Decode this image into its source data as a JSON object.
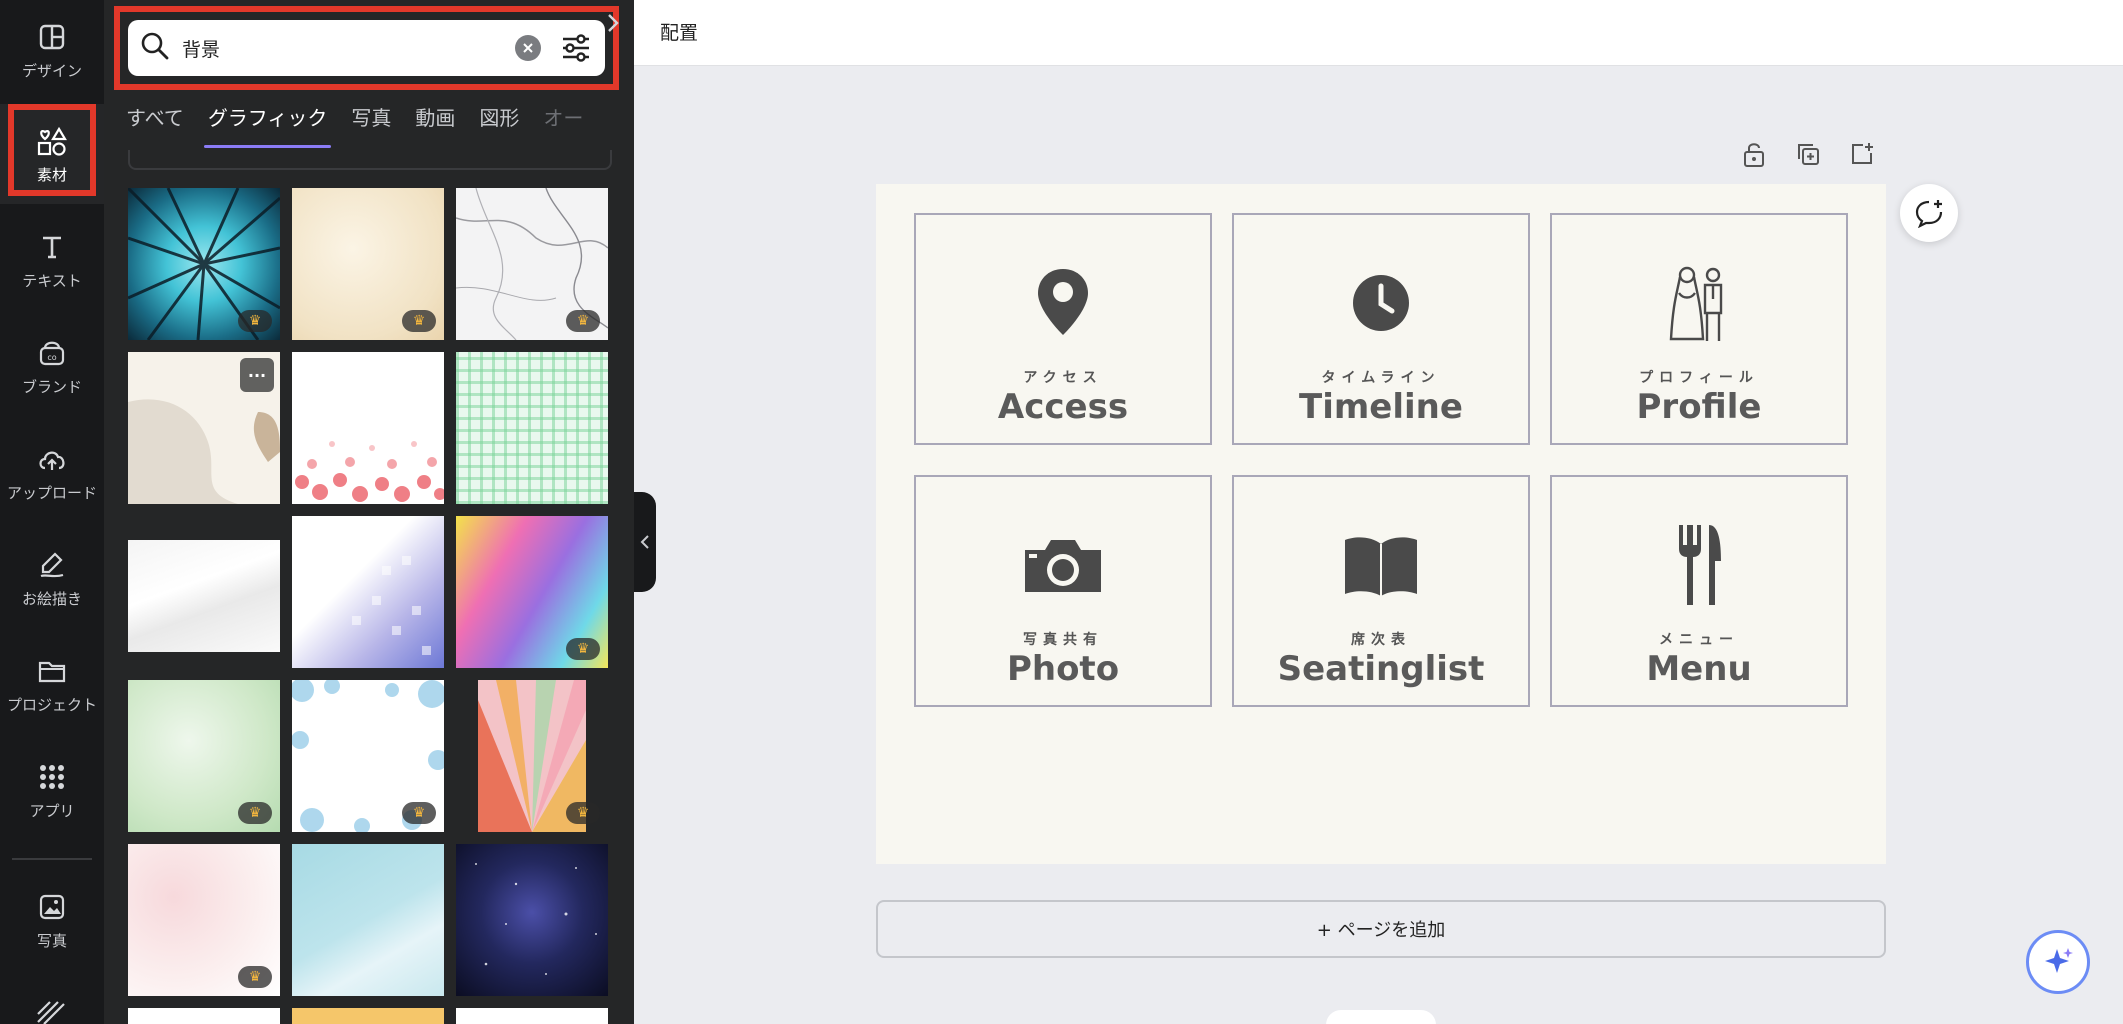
{
  "rail": {
    "items": [
      {
        "label": "デザイン",
        "icon": "layout-icon"
      },
      {
        "label": "素材",
        "icon": "elements-icon"
      },
      {
        "label": "テキスト",
        "icon": "text-icon"
      },
      {
        "label": "ブランド",
        "icon": "brand-icon"
      },
      {
        "label": "アップロード",
        "icon": "upload-cloud-icon"
      },
      {
        "label": "お絵描き",
        "icon": "draw-icon"
      },
      {
        "label": "プロジェクト",
        "icon": "folder-icon"
      },
      {
        "label": "アプリ",
        "icon": "apps-grid-icon"
      },
      {
        "label": "写真",
        "icon": "photo-icon"
      }
    ]
  },
  "search": {
    "value": "背景",
    "placeholder": ""
  },
  "tabs": [
    "すべて",
    "グラフィック",
    "写真",
    "動画",
    "図形",
    "オー"
  ],
  "topbar": {
    "title": "配置"
  },
  "cards": [
    {
      "sub": "アクセス",
      "title": "Access",
      "icon": "map-pin-icon"
    },
    {
      "sub": "タイムライン",
      "title": "Timeline",
      "icon": "clock-icon"
    },
    {
      "sub": "プロフィール",
      "title": "Profile",
      "icon": "couple-icon"
    },
    {
      "sub": "写真共有",
      "title": "Photo",
      "icon": "camera-icon"
    },
    {
      "sub": "席次表",
      "title": "Seatinglist",
      "icon": "book-icon"
    },
    {
      "sub": "メニュー",
      "title": "Menu",
      "icon": "cutlery-icon"
    }
  ],
  "add_page": "+ ページを追加",
  "colors": {
    "highlight": "#e2382a",
    "accent": "#8b7cf6",
    "rail_bg": "#18191b",
    "panel_bg": "#252627"
  }
}
